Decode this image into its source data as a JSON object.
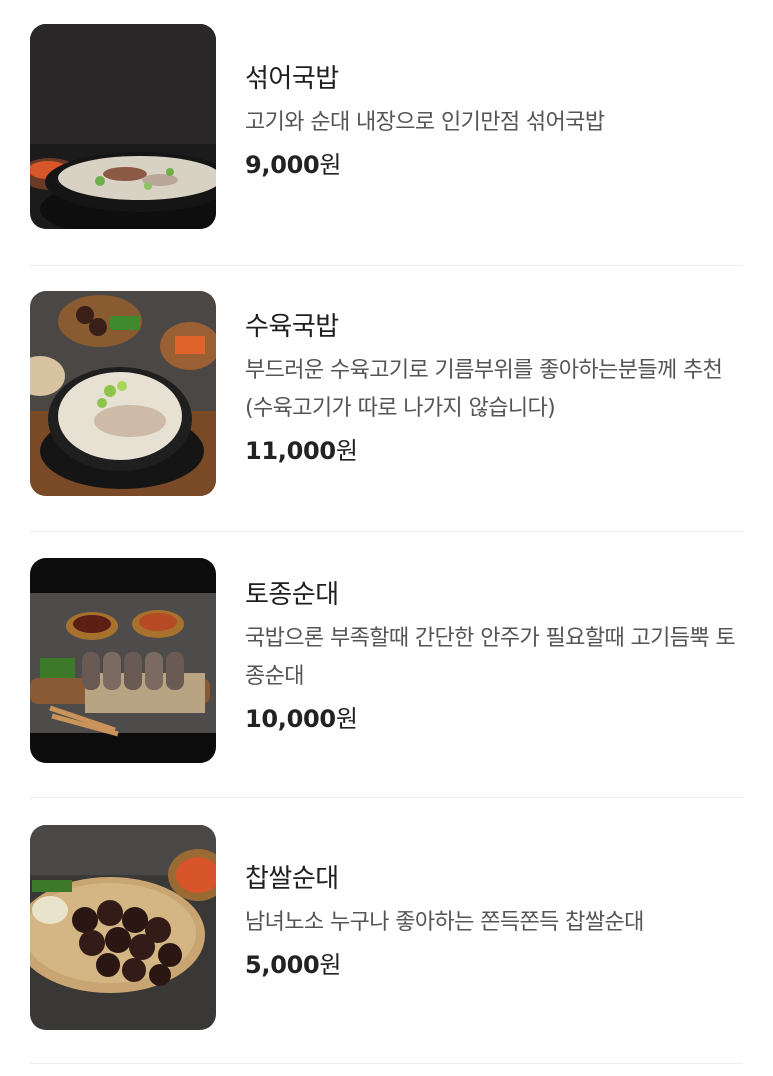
{
  "menu": {
    "items": [
      {
        "name": "섞어국밥",
        "description": "고기와 순대 내장으로 인기만점 섞어국밥",
        "price": "9,000",
        "currency": "원",
        "image_icon": "gukbap-bowl-image"
      },
      {
        "name": "수육국밥",
        "description": "부드러운 수육고기로 기름부위를 좋아하는분들께 추천(수육고기가 따로 나가지 않습니다)",
        "price": "11,000",
        "currency": "원",
        "image_icon": "suyuk-gukbap-image"
      },
      {
        "name": "토종순대",
        "description": "국밥으론 부족할때 간단한 안주가 필요할때 고기듬뿍 토종순대",
        "price": "10,000",
        "currency": "원",
        "image_icon": "sundae-platter-image"
      },
      {
        "name": "찹쌀순대",
        "description": "남녀노소 누구나 좋아하는 쫀득쫀득 찹쌀순대",
        "price": "5,000",
        "currency": "원",
        "image_icon": "chapssal-sundae-image"
      }
    ]
  }
}
